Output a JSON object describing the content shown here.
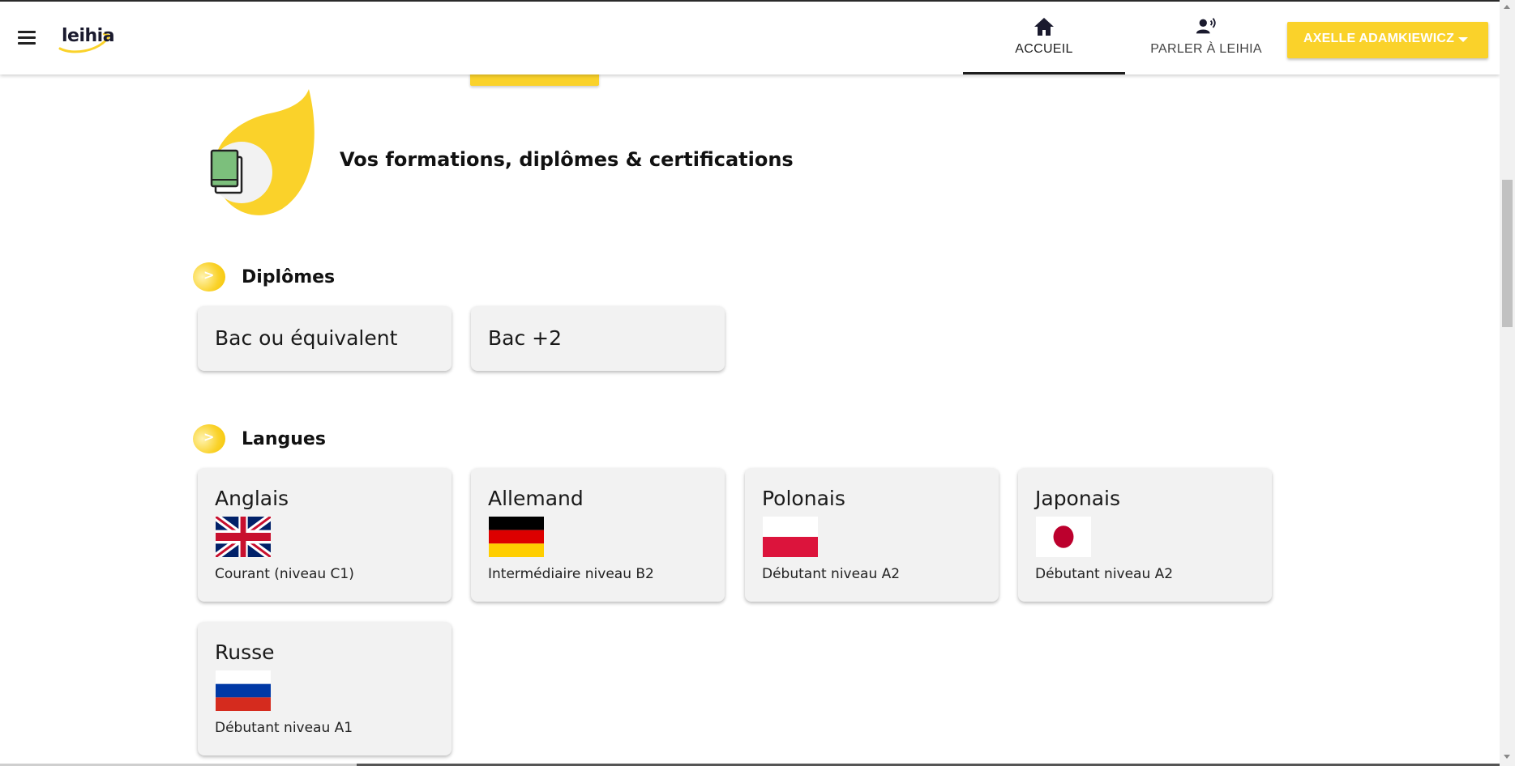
{
  "header": {
    "logo_text": "leihia",
    "nav": [
      {
        "label": "ACCUEIL",
        "icon": "home-icon",
        "active": true
      },
      {
        "label": "PARLER À LEIHIA",
        "icon": "voice-user-icon",
        "active": false
      }
    ],
    "user_name": "AXELLE ADAMKIEWICZ",
    "accent_color": "#fad22a"
  },
  "main": {
    "section_title": "Vos formations, diplômes & certifications",
    "section_icon": "book-icon",
    "diplomas": {
      "heading": "Diplômes",
      "items": [
        {
          "label": "Bac ou équivalent"
        },
        {
          "label": "Bac +2"
        }
      ]
    },
    "languages": {
      "heading": "Langues",
      "items": [
        {
          "name": "Anglais",
          "flag": "uk-flag-icon",
          "level": "Courant (niveau C1)"
        },
        {
          "name": "Allemand",
          "flag": "germany-flag-icon",
          "level": "Intermédiaire niveau B2"
        },
        {
          "name": "Polonais",
          "flag": "poland-flag-icon",
          "level": "Débutant niveau A2"
        },
        {
          "name": "Japonais",
          "flag": "japan-flag-icon",
          "level": "Débutant niveau A2"
        },
        {
          "name": "Russe",
          "flag": "russia-flag-icon",
          "level": "Débutant niveau A1"
        }
      ]
    }
  }
}
